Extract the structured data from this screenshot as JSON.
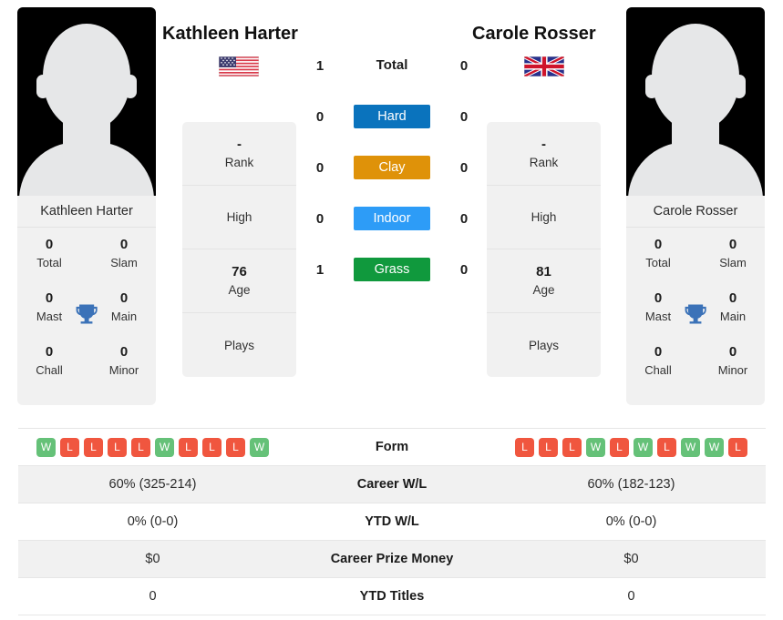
{
  "players": {
    "left": {
      "name": "Kathleen Harter",
      "flag": "us-flag-icon",
      "photo_name": "player-photo-placeholder",
      "titles": {
        "total_val": "0",
        "total_lab": "Total",
        "slam_val": "0",
        "slam_lab": "Slam",
        "mast_val": "0",
        "mast_lab": "Mast",
        "main_val": "0",
        "main_lab": "Main",
        "chall_val": "0",
        "chall_lab": "Chall",
        "minor_val": "0",
        "minor_lab": "Minor"
      },
      "info": {
        "rank_val": "-",
        "rank_lab": "Rank",
        "high_val": "",
        "high_lab": "High",
        "age_val": "76",
        "age_lab": "Age",
        "plays_val": "",
        "plays_lab": "Plays"
      },
      "form": [
        "W",
        "L",
        "L",
        "L",
        "L",
        "W",
        "L",
        "L",
        "L",
        "W"
      ],
      "career_wl": "60% (325-214)",
      "ytd_wl": "0% (0-0)",
      "career_prize": "$0",
      "ytd_titles": "0"
    },
    "right": {
      "name": "Carole Rosser",
      "flag": "gb-flag-icon",
      "photo_name": "player-photo-placeholder",
      "titles": {
        "total_val": "0",
        "total_lab": "Total",
        "slam_val": "0",
        "slam_lab": "Slam",
        "mast_val": "0",
        "mast_lab": "Mast",
        "main_val": "0",
        "main_lab": "Main",
        "chall_val": "0",
        "chall_lab": "Chall",
        "minor_val": "0",
        "minor_lab": "Minor"
      },
      "info": {
        "rank_val": "-",
        "rank_lab": "Rank",
        "high_val": "",
        "high_lab": "High",
        "age_val": "81",
        "age_lab": "Age",
        "plays_val": "",
        "plays_lab": "Plays"
      },
      "form": [
        "L",
        "L",
        "L",
        "W",
        "L",
        "W",
        "L",
        "W",
        "W",
        "L"
      ],
      "career_wl": "60% (182-123)",
      "ytd_wl": "0% (0-0)",
      "career_prize": "$0",
      "ytd_titles": "0"
    }
  },
  "h2h": {
    "rows": [
      {
        "label": "Total",
        "left": "1",
        "right": "0",
        "color": ""
      },
      {
        "label": "Hard",
        "left": "0",
        "right": "0",
        "color": "#0a73bd"
      },
      {
        "label": "Clay",
        "left": "0",
        "right": "0",
        "color": "#df9209"
      },
      {
        "label": "Indoor",
        "left": "0",
        "right": "0",
        "color": "#2d9cf7"
      },
      {
        "label": "Grass",
        "left": "1",
        "right": "0",
        "color": "#10993d"
      }
    ]
  },
  "table": {
    "rows": [
      {
        "label": "Form",
        "type": "form"
      },
      {
        "label": "Career W/L",
        "type": "text"
      },
      {
        "label": "YTD W/L",
        "type": "text"
      },
      {
        "label": "Career Prize Money",
        "type": "text"
      },
      {
        "label": "YTD Titles",
        "type": "text"
      }
    ]
  },
  "colors": {
    "win": "#65c178",
    "loss": "#f0563f",
    "card_bg": "#f1f1f1",
    "hard": "#0a73bd",
    "clay": "#df9209",
    "indoor": "#2d9cf7",
    "grass": "#10993d"
  }
}
